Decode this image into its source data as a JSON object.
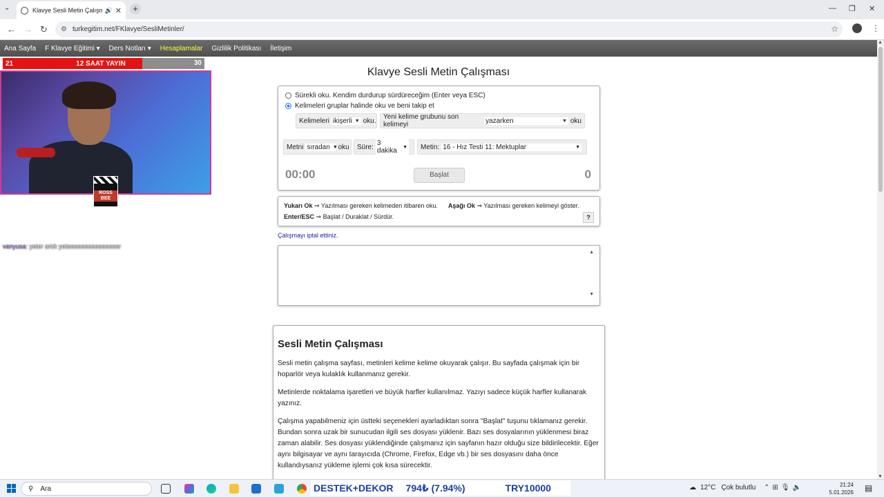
{
  "browser": {
    "tab_title": "Klavye Sesli Metin Çalışması",
    "url": "turkegitim.net/FKlavye/SesliMetinler/",
    "new_tab_icon": "plus-icon",
    "window_controls": [
      "—",
      "❐",
      "✕"
    ]
  },
  "site_nav": {
    "items": [
      {
        "label": "Ana Sayfa",
        "active": false
      },
      {
        "label": "F Klavye Eğitimi ▾",
        "active": false
      },
      {
        "label": "Ders Notları ▾",
        "active": false
      },
      {
        "label": "Hesaplamalar",
        "active": true
      },
      {
        "label": "Gizlilik Politikası",
        "active": false
      },
      {
        "label": "İletişim",
        "active": false
      }
    ],
    "active_color": "#ffff33"
  },
  "page": {
    "title": "Klavye Sesli Metin Çalışması",
    "options": {
      "radio1": "Sürekli oku. Kendim durdurup sürdüreceğim (Enter veya ESC)",
      "radio2": "Kelimeleri gruplar halinde oku ve beni takip et",
      "selected_radio": 2,
      "group1": {
        "prefix": "Kelimeleri",
        "value": "ikişerli",
        "suffix": "oku."
      },
      "group2": {
        "prefix": "Yeni kelime grubunu son kelimeyi",
        "value": "yazarken",
        "suffix": "oku"
      },
      "group3": {
        "prefix": "Metni",
        "value": "sıradan",
        "suffix": "oku"
      },
      "group4": {
        "prefix": "Süre:",
        "value": "3 dakika"
      },
      "group5": {
        "prefix": "Metin:",
        "value": "16 - Hız Testi 11: Mektuplar"
      },
      "timer": "00:00",
      "start_label": "Başlat",
      "counter": "0"
    },
    "help": {
      "up_key": "Yukarı Ok",
      "up_text": "⇒ Yazılması gereken kelimeden itibaren oku.",
      "down_key": "Aşağı Ok",
      "down_text": "⇒ Yazılması gereken kelimeyi göster.",
      "enter_key": "Enter/ESC",
      "enter_text": "⇒ Başlat / Duraklat / Sürdür.",
      "help_button": "?"
    },
    "cancel_message": "Çalışmayı iptal ettiniz.",
    "article": {
      "heading": "Sesli Metin Çalışması",
      "p1": "Sesli metin çalışma sayfası, metinleri kelime kelime okuyarak çalışır. Bu sayfada çalışmak için bir hoparlör veya kulaklık kullanmanız gerekir.",
      "p2": "Metinlerde noktalama işaretleri ve büyük harfler kullanılmaz. Yazıyı sadece küçük harfler kullanarak yazınız.",
      "p3": "Çalışma yapabilmeniz için üstteki seçenekleri ayarladıktan sonra \"Başlat\" tuşunu tıklamanız gerekir. Bundan sonra uzak bir sunucudan ilgili ses dosyası yüklenir. Bazı ses dosyalarının yüklenmesi biraz zaman alabilir. Ses dosyası yüklendiğinde çalışmanız için sayfanın hazır olduğu size bildirilecektir. Eğer aynı bilgisayar ve aynı tarayıcıda (Chrome, Firefox, Edge vb.) bir ses dosyasını daha önce kullandıysanız yükleme işlemi çok kısa sürecektir."
    }
  },
  "overlay": {
    "left_num": "21",
    "banner": "12 SAAT YAYIN",
    "right_num": "30",
    "clapper_text": "ROSS BEE",
    "chat_user": "vanyusa",
    "chat_msg": ": yeter artık yeteeeeeeeeeeeeeeer"
  },
  "taskbar": {
    "search_placeholder": "Ara",
    "ticker1": "DESTEK+DEKOR",
    "ticker2": "794₺ (7.94%)",
    "ticker3": "TRY10000",
    "temp": "12°C",
    "weather": "Çok bulutlu",
    "time": "21:24",
    "date": "5.01.2026"
  }
}
